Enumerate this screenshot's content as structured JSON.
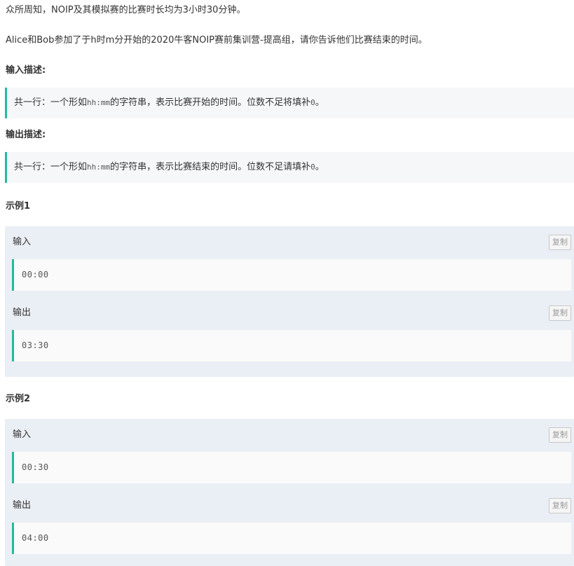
{
  "description": {
    "line1": "众所周知，NOIP及其模拟赛的比赛时长均为3小时30分钟。",
    "line2": "Alice和Bob参加了于h时m分开始的2020牛客NOIP赛前集训营-提高组，请你告诉他们比赛结束的时间。"
  },
  "input_section": {
    "heading": "输入描述:",
    "text_before": "共一行：一个形如",
    "code": "hh:mm",
    "text_middle": "的字符串，表示比赛开始的时间。位数不足将填补",
    "code_zero": "0",
    "text_after": "。"
  },
  "output_section": {
    "heading": "输出描述:",
    "text_before": "共一行：一个形如",
    "code": "hh:mm",
    "text_middle": "的字符串，表示比赛结束的时间。位数不足请填补",
    "code_zero": "0",
    "text_after": "。"
  },
  "examples": [
    {
      "title": "示例1",
      "input_label": "输入",
      "input_value": "00:00",
      "output_label": "输出",
      "output_value": "03:30",
      "copy_label": "复制"
    },
    {
      "title": "示例2",
      "input_label": "输入",
      "input_value": "00:30",
      "output_label": "输出",
      "output_value": "04:00",
      "copy_label": "复制"
    }
  ],
  "colors": {
    "accent": "#25bb9b",
    "example_bg": "#eaeef5",
    "quote_bg": "#f6f7f9"
  }
}
